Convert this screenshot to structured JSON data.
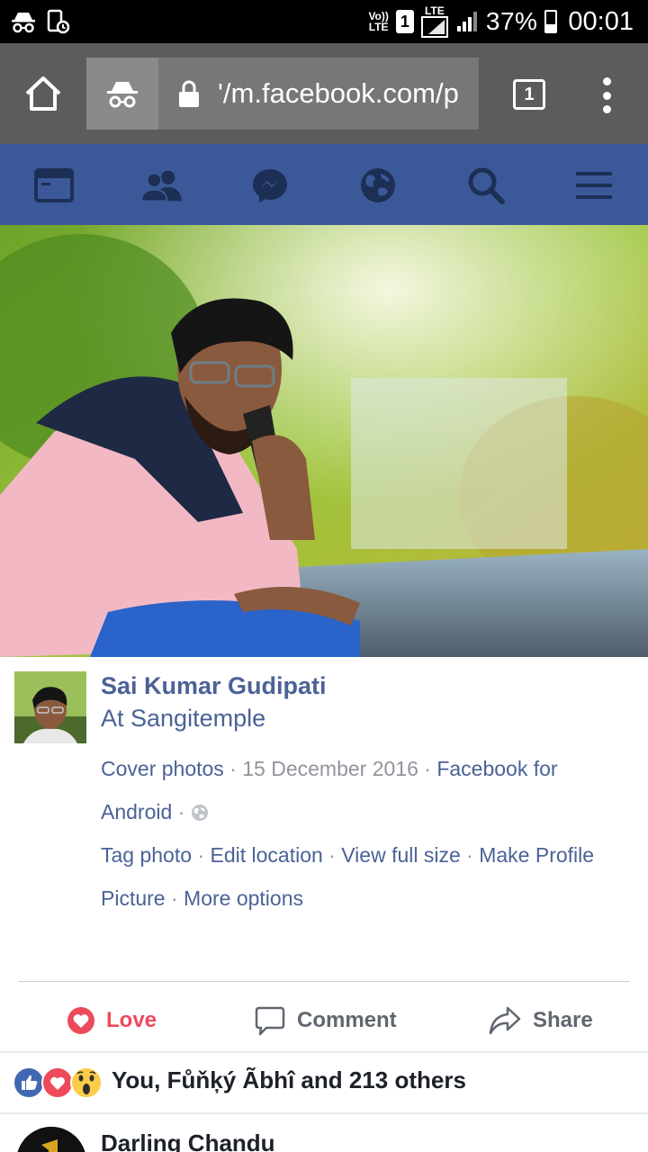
{
  "status_bar": {
    "volte_label": "Vo))\nLTE",
    "sim_number": "1",
    "lte_label": "LTE",
    "battery_percent": "37%",
    "battery_level": 0.37,
    "time": "00:01"
  },
  "browser": {
    "url": "'/m.facebook.com/p",
    "tab_count": "1"
  },
  "nav": {
    "items": [
      "news-feed-icon",
      "friends-icon",
      "messenger-icon",
      "notifications-globe-icon",
      "search-icon",
      "menu-icon"
    ]
  },
  "post": {
    "author": "Sai Kumar Gudipati",
    "location": "At Sangitemple",
    "album": "Cover photos",
    "date": "15 December 2016",
    "source": "Facebook for Android",
    "links": [
      "Tag photo",
      "Edit location",
      "View full size",
      "Make Profile Picture",
      "More options"
    ],
    "actions": {
      "love": "Love",
      "comment": "Comment",
      "share": "Share"
    }
  },
  "reactions": {
    "summary": "You, Fůňķý Ãbhî and 213 others",
    "icons": [
      "like-icon",
      "love-icon",
      "wow-icon"
    ]
  },
  "comment_preview": {
    "author": "Darling Chandu"
  },
  "colors": {
    "fb_blue": "#3b5998",
    "link_blue": "#4b6296",
    "love_red": "#ed4a5b"
  }
}
